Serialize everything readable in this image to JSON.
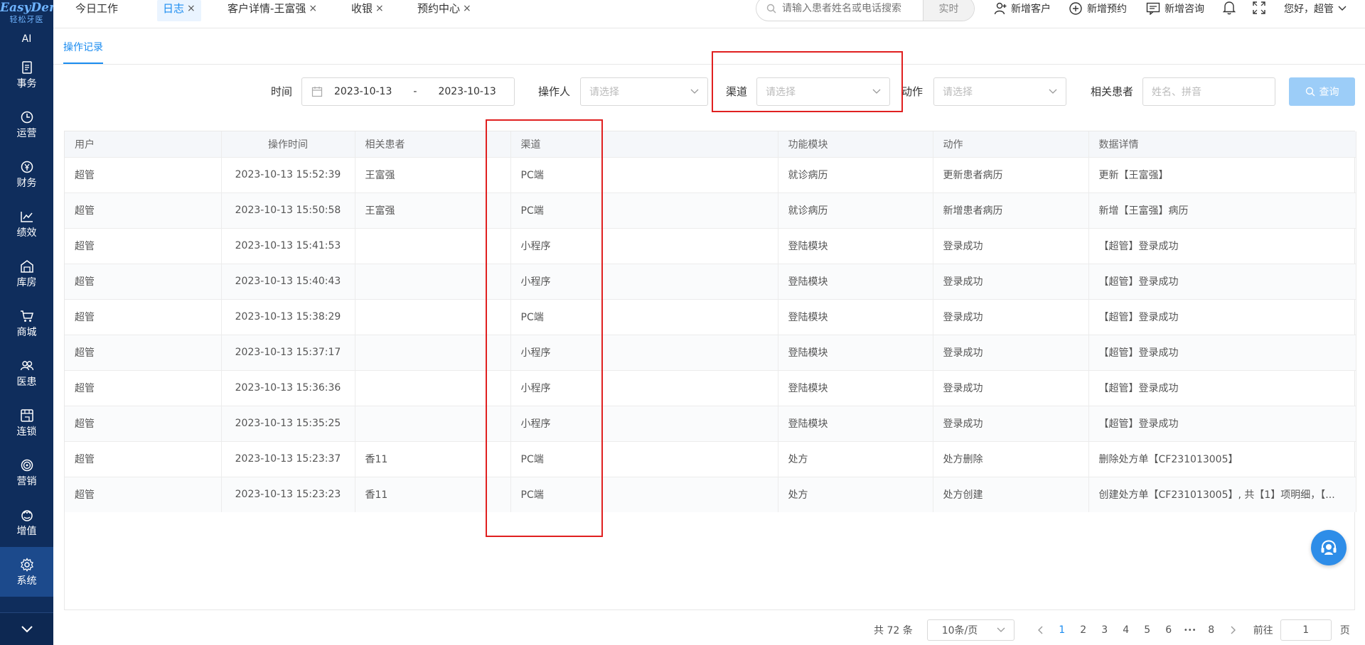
{
  "brand": {
    "logo_text": "EasyDent",
    "logo_sub": "轻松牙医"
  },
  "sidebar": {
    "ai_label": "AI",
    "items": [
      {
        "label": "事务",
        "icon": "clipboard-icon"
      },
      {
        "label": "运营",
        "icon": "clock-icon"
      },
      {
        "label": "财务",
        "icon": "yen-icon"
      },
      {
        "label": "绩效",
        "icon": "line-chart-icon"
      },
      {
        "label": "库房",
        "icon": "warehouse-icon"
      },
      {
        "label": "商城",
        "icon": "cart-icon"
      },
      {
        "label": "医患",
        "icon": "users-icon"
      },
      {
        "label": "连锁",
        "icon": "store-icon"
      },
      {
        "label": "营销",
        "icon": "target-icon"
      },
      {
        "label": "增值",
        "icon": "gift-icon"
      },
      {
        "label": "系统",
        "icon": "gear-icon"
      }
    ]
  },
  "tabs": [
    {
      "label": "今日工作",
      "closable": false
    },
    {
      "label": "日志",
      "closable": true,
      "active": true
    },
    {
      "label": "客户详情-王富强",
      "closable": true
    },
    {
      "label": "收银",
      "closable": true
    },
    {
      "label": "预约中心",
      "closable": true
    }
  ],
  "close_glyph": "×",
  "header": {
    "search_placeholder": "请输入患者姓名或电话搜索",
    "search_realtime": "实时",
    "new_customer": "新增客户",
    "new_appointment": "新增预约",
    "new_consult": "新增咨询",
    "greeting": "您好，超管"
  },
  "subtab": {
    "label": "操作记录"
  },
  "filters": {
    "time_label": "时间",
    "date_start": "2023-10-13",
    "date_sep": "-",
    "date_end": "2023-10-13",
    "operator_label": "操作人",
    "operator_placeholder": "请选择",
    "channel_label": "渠道",
    "channel_placeholder": "请选择",
    "action_label": "动作",
    "action_placeholder": "请选择",
    "patient_label": "相关患者",
    "patient_placeholder": "姓名、拼音",
    "query_label": "查询"
  },
  "table": {
    "columns": [
      "用户",
      "操作时间",
      "相关患者",
      "",
      "渠道",
      "功能模块",
      "动作",
      "数据详情"
    ],
    "rows": [
      [
        "超管",
        "2023-10-13 15:52:39",
        "王富强",
        "",
        "PC端",
        "就诊病历",
        "更新患者病历",
        "更新【王富强】"
      ],
      [
        "超管",
        "2023-10-13 15:50:58",
        "王富强",
        "",
        "PC端",
        "就诊病历",
        "新增患者病历",
        "新增【王富强】病历"
      ],
      [
        "超管",
        "2023-10-13 15:41:53",
        "",
        "",
        "小程序",
        "登陆模块",
        "登录成功",
        "【超管】登录成功"
      ],
      [
        "超管",
        "2023-10-13 15:40:43",
        "",
        "",
        "小程序",
        "登陆模块",
        "登录成功",
        "【超管】登录成功"
      ],
      [
        "超管",
        "2023-10-13 15:38:29",
        "",
        "",
        "PC端",
        "登陆模块",
        "登录成功",
        "【超管】登录成功"
      ],
      [
        "超管",
        "2023-10-13 15:37:17",
        "",
        "",
        "小程序",
        "登陆模块",
        "登录成功",
        "【超管】登录成功"
      ],
      [
        "超管",
        "2023-10-13 15:36:36",
        "",
        "",
        "小程序",
        "登陆模块",
        "登录成功",
        "【超管】登录成功"
      ],
      [
        "超管",
        "2023-10-13 15:35:25",
        "",
        "",
        "小程序",
        "登陆模块",
        "登录成功",
        "【超管】登录成功"
      ],
      [
        "超管",
        "2023-10-13 15:23:37",
        "香11",
        "",
        "PC端",
        "处方",
        "处方删除",
        "删除处方单【CF231013005】"
      ],
      [
        "超管",
        "2023-10-13 15:23:23",
        "香11",
        "",
        "PC端",
        "处方",
        "处方创建",
        "创建处方单【CF231013005】, 共【1】项明细，【..."
      ]
    ]
  },
  "pagination": {
    "total_text": "共 72 条",
    "page_size": "10条/页",
    "pages": [
      "1",
      "2",
      "3",
      "4",
      "5",
      "6"
    ],
    "ellipsis": "•••",
    "last_page": "8",
    "current": "1",
    "goto_label": "前往",
    "goto_value": "1",
    "goto_suffix": "页"
  },
  "colors": {
    "sidebar_bg": "#0f2d5c",
    "accent": "#1b8cf0",
    "highlight_box": "#e02020"
  }
}
